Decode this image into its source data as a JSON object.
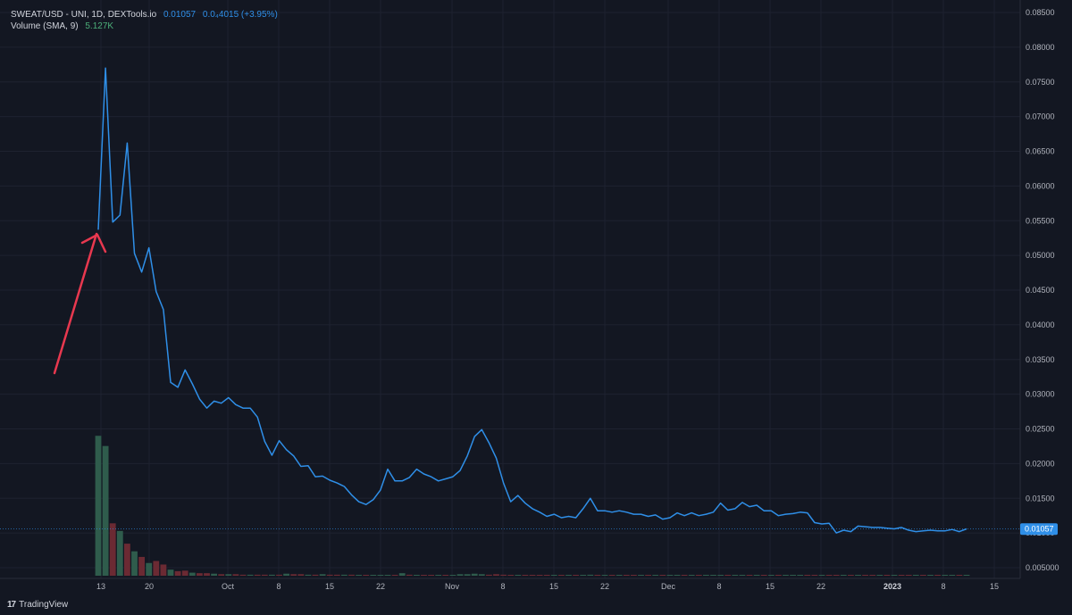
{
  "legend": {
    "symbol": "SWEAT/USD - UNI, 1D, DEXTools.io",
    "last": "0.01057",
    "change": "0.0₄4015 (+3.95%)",
    "volume_label": "Volume (SMA, 9)",
    "volume_value": "5.127K"
  },
  "colors": {
    "background": "#131722",
    "line": "#2f8fe8",
    "up_volume": "#2f5c4c",
    "down_volume": "#6b2a33",
    "arrow": "#e8384f",
    "grid": "#1e2230"
  },
  "price_axis": {
    "ticks": [
      "0.08500",
      "0.08000",
      "0.07500",
      "0.07000",
      "0.06500",
      "0.06000",
      "0.05500",
      "0.05000",
      "0.04500",
      "0.04000",
      "0.03500",
      "0.03000",
      "0.02500",
      "0.02000",
      "0.01500",
      "0.01000",
      "0.005000"
    ],
    "last_price_label": "0.01057"
  },
  "time_axis": {
    "ticks": [
      {
        "label": "13",
        "bold": false
      },
      {
        "label": "20",
        "bold": false
      },
      {
        "label": "Oct",
        "bold": false
      },
      {
        "label": "8",
        "bold": false
      },
      {
        "label": "15",
        "bold": false
      },
      {
        "label": "22",
        "bold": false
      },
      {
        "label": "Nov",
        "bold": false
      },
      {
        "label": "8",
        "bold": false
      },
      {
        "label": "15",
        "bold": false
      },
      {
        "label": "22",
        "bold": false
      },
      {
        "label": "Dec",
        "bold": false
      },
      {
        "label": "8",
        "bold": false
      },
      {
        "label": "15",
        "bold": false
      },
      {
        "label": "22",
        "bold": false
      },
      {
        "label": "2023",
        "bold": true
      },
      {
        "label": "8",
        "bold": false
      },
      {
        "label": "15",
        "bold": false
      }
    ]
  },
  "footer": {
    "brand": "TradingView"
  },
  "chart_data": {
    "type": "line",
    "title": "SWEAT/USD - UNI, 1D, DEXTools.io",
    "x_start": "2022-09-13",
    "x_end": "2023-01-04",
    "ylim": [
      0.004,
      0.0855
    ],
    "series": [
      {
        "name": "SWEAT/USD",
        "values": [
          0.0537,
          0.077,
          0.0548,
          0.0558,
          0.0662,
          0.0503,
          0.0476,
          0.0511,
          0.0448,
          0.0422,
          0.0317,
          0.031,
          0.0335,
          0.0315,
          0.0293,
          0.028,
          0.029,
          0.0287,
          0.0295,
          0.0285,
          0.028,
          0.028,
          0.0267,
          0.0232,
          0.0212,
          0.0233,
          0.022,
          0.0211,
          0.0196,
          0.0197,
          0.0181,
          0.0182,
          0.0176,
          0.0172,
          0.0167,
          0.0155,
          0.0145,
          0.0141,
          0.0148,
          0.0162,
          0.0192,
          0.0175,
          0.0175,
          0.018,
          0.0192,
          0.0185,
          0.0181,
          0.0175,
          0.0178,
          0.0181,
          0.019,
          0.0211,
          0.0239,
          0.0249,
          0.023,
          0.0208,
          0.0172,
          0.0145,
          0.0154,
          0.0143,
          0.0135,
          0.013,
          0.0124,
          0.0127,
          0.0122,
          0.0124,
          0.0122,
          0.0135,
          0.015,
          0.0132,
          0.0132,
          0.013,
          0.0132,
          0.013,
          0.0127,
          0.0127,
          0.0124,
          0.0126,
          0.012,
          0.0122,
          0.0129,
          0.0125,
          0.0129,
          0.0125,
          0.0127,
          0.013,
          0.0143,
          0.0133,
          0.0135,
          0.0144,
          0.0138,
          0.014,
          0.0132,
          0.0132,
          0.0125,
          0.0127,
          0.0128,
          0.013,
          0.0129,
          0.0115,
          0.0113,
          0.0114,
          0.01,
          0.0104,
          0.0102,
          0.011,
          0.0109,
          0.0108,
          0.0108,
          0.0107,
          0.0106,
          0.0108,
          0.0104,
          0.0102,
          0.0103,
          0.0104,
          0.0103,
          0.0103,
          0.0105,
          0.0102,
          0.0106
        ]
      },
      {
        "name": "Volume",
        "values": [
          27.5,
          25.5,
          10.3,
          8.8,
          6.3,
          4.8,
          3.7,
          2.5,
          2.9,
          2.2,
          1.2,
          0.9,
          1.0,
          0.6,
          0.5,
          0.5,
          0.4,
          0.3,
          0.3,
          0.3,
          0.2,
          0.2,
          0.2,
          0.2,
          0.2,
          0.2,
          0.4,
          0.3,
          0.3,
          0.2,
          0.2,
          0.3,
          0.2,
          0.2,
          0.2,
          0.2,
          0.1,
          0.1,
          0.1,
          0.1,
          0.1,
          0.1,
          0.5,
          0.2,
          0.1,
          0.1,
          0.1,
          0.1,
          0.1,
          0.1,
          0.3,
          0.3,
          0.4,
          0.3,
          0.2,
          0.3,
          0.2,
          0.1,
          0.1,
          0.1,
          0.1,
          0.1,
          0.1,
          0.1,
          0.1,
          0.1,
          0.1,
          0.1,
          0.2,
          0.1,
          0.1,
          0.1,
          0.1,
          0.1,
          0.1,
          0.1,
          0.1,
          0.1,
          0.1,
          0.1,
          0.1,
          0.1,
          0.1,
          0.1,
          0.1,
          0.1,
          0.1,
          0.1,
          0.1,
          0.1,
          0.1,
          0.1,
          0.1,
          0.1,
          0.1,
          0.1,
          0.1,
          0.1,
          0.1,
          0.1,
          0.1,
          0.1,
          0.1,
          0.1,
          0.1,
          0.1,
          0.1,
          0.1,
          0.1,
          0.1,
          0.1,
          0.1,
          0.1,
          0.1,
          0.1,
          0.1,
          0.1,
          0.1,
          0.1,
          0.1,
          0.1
        ],
        "up": [
          true,
          true,
          false,
          true,
          false,
          true,
          false,
          true,
          false,
          false,
          true,
          false,
          false,
          true,
          false,
          false,
          true,
          false,
          true,
          false,
          false,
          true,
          false,
          false,
          true,
          false,
          true,
          false,
          false,
          true,
          false,
          true,
          false,
          false,
          true,
          false,
          true,
          false,
          true,
          true,
          true,
          false,
          true,
          false,
          true,
          false,
          false,
          true,
          false,
          true,
          true,
          true,
          true,
          true,
          false,
          false,
          false,
          false,
          true,
          false,
          false,
          false,
          false,
          true,
          false,
          true,
          false,
          true,
          true,
          false,
          true,
          false,
          true,
          false,
          false,
          true,
          false,
          true,
          false,
          true,
          true,
          false,
          true,
          false,
          true,
          true,
          true,
          false,
          true,
          true,
          false,
          true,
          false,
          true,
          false,
          true,
          true,
          true,
          false,
          false,
          true,
          false,
          false,
          true,
          false,
          true,
          false,
          false,
          true,
          false,
          true,
          false,
          false,
          true,
          false,
          true,
          false,
          true,
          true,
          false,
          true
        ]
      }
    ]
  }
}
